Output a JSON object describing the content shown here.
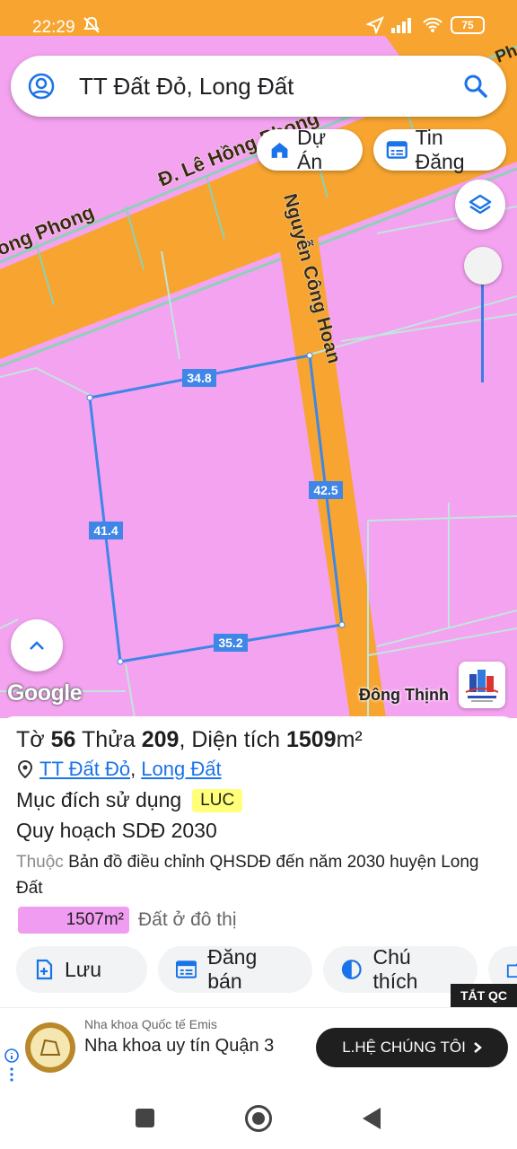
{
  "status_bar": {
    "time": "22:29",
    "battery": "75"
  },
  "search": {
    "query": "TT Đất Đỏ, Long Đất"
  },
  "chips": {
    "du_an": "Dự Án",
    "tin_dang": "Tin Đăng"
  },
  "map": {
    "street_le_hong": "Đ. Lê Hồng Phong",
    "street_ong_phong": "ong Phong",
    "street_nguyen": "Nguyễn Công Hoan",
    "corner_label": "Ph",
    "edges": {
      "top": "34.8",
      "right": "42.5",
      "left": "41.4",
      "bottom": "35.2"
    },
    "google": "Google",
    "brand": "Đông Thịnh",
    "colors": {
      "land": "#f4a3f0",
      "road": "#f7a530",
      "boundary": "#3f86e6"
    }
  },
  "parcel": {
    "to_label": "Tờ",
    "to_value": "56",
    "thua_label": "Thửa",
    "thua_value": "209",
    "dien_tich_label": ", Diện tích",
    "dien_tich_value": "1509",
    "unit": "m²",
    "ward": "TT Đất Đỏ",
    "district": "Long Đất",
    "purpose_label": "Mục đích sử dụng",
    "purpose_code": "LUC",
    "plan_title": "Quy hoạch SDĐ 2030",
    "belong_muted": "Thuộc",
    "belong_text": "Bản đồ điều chỉnh QHSDĐ đến năm 2030 huyện Long Đất",
    "area_value": "1507m²",
    "area_label": "Đất ở đô thị"
  },
  "actions": {
    "luu": "Lưu",
    "dang_ban": "Đăng bán",
    "chu_thich": "Chú thích"
  },
  "ad": {
    "close": "TẮT QC",
    "advertiser": "Nha khoa Quốc tế Emis",
    "headline": "Nha khoa uy tín Quận 3",
    "cta": "L.HỆ CHÚNG TÔI"
  }
}
